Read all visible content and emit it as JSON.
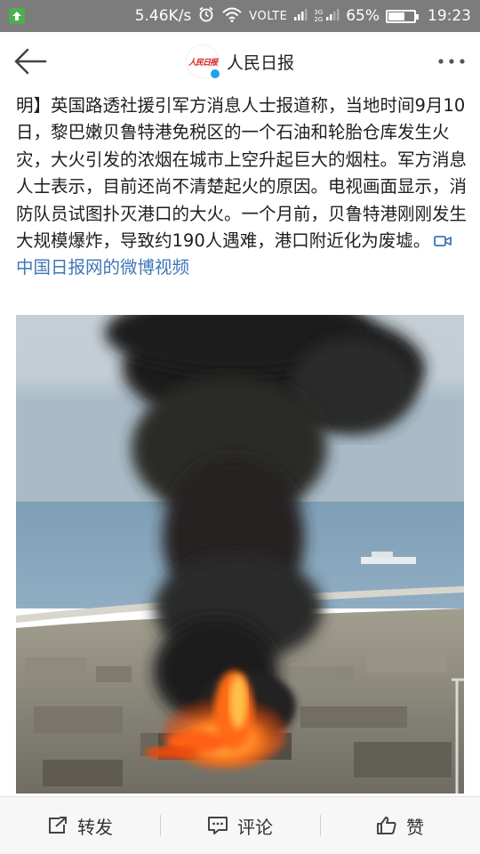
{
  "status_bar": {
    "speed": "5.46K/s",
    "network_label": "VOLTE",
    "network_types": [
      "3G",
      "2G"
    ],
    "battery_text": "65%",
    "battery_level": 0.65,
    "time": "19:23",
    "icons": [
      "upload-notification-icon",
      "alarm-icon",
      "wifi-icon",
      "signal-icon",
      "signal-icon",
      "battery-icon"
    ]
  },
  "header": {
    "title": "人民日报",
    "avatar_text": "人民日报",
    "icons": [
      "back-arrow-icon",
      "verified-icon",
      "more-dots-icon"
    ]
  },
  "article": {
    "body": "明】英国路透社援引军方消息人士报道称，当地时间9月10日，黎巴嫩贝鲁特港免税区的一个石油和轮胎仓库发生火灾，大火引发的浓烟在城市上空升起巨大的烟柱。军方消息人士表示，目前还尚不清楚起火的原因。电视画面显示，消防队员试图扑灭港口的大火。一个月前，贝鲁特港刚刚发生大规模爆炸，导致约190人遇难，港口附近化为废墟。",
    "source_link": "中国日报网的微博视频",
    "link_color": "#3d76b8"
  },
  "actions": {
    "repost": "转发",
    "comment": "评论",
    "like": "赞"
  }
}
